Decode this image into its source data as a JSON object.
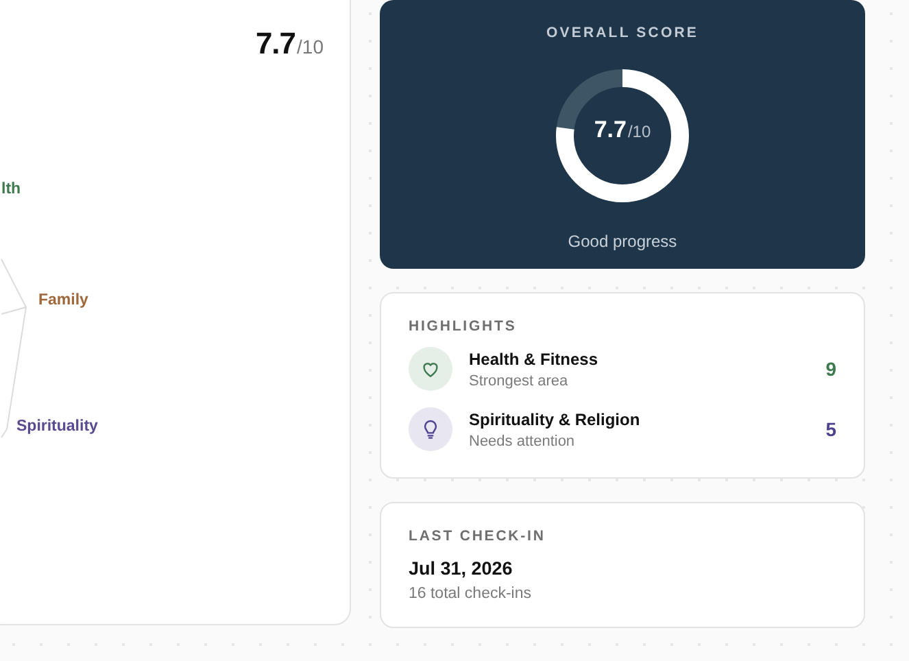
{
  "radar_card": {
    "score": "7.7",
    "score_max": "/10",
    "axis_labels": [
      {
        "text": "lth",
        "color": "#3d7a4f"
      },
      {
        "text": "Family",
        "color": "#a0683a"
      },
      {
        "text": "Spirituality",
        "color": "#5a4a8f"
      }
    ]
  },
  "overall": {
    "title": "OVERALL SCORE",
    "score": "7.7",
    "score_max": "/10",
    "level": 0.77,
    "caption": "Good progress"
  },
  "highlights": {
    "title": "HIGHLIGHTS",
    "items": [
      {
        "kind": "heart",
        "name": "Health & Fitness",
        "note": "Strongest area",
        "score": "9",
        "color": "#3d7a4f"
      },
      {
        "kind": "bulb",
        "name": "Spirituality & Religion",
        "note": "Needs attention",
        "score": "5",
        "color": "#4e4290"
      }
    ]
  },
  "last_checkin": {
    "title": "LAST CHECK-IN",
    "date": "Jul 31, 2026",
    "count": "16 total check-ins"
  }
}
